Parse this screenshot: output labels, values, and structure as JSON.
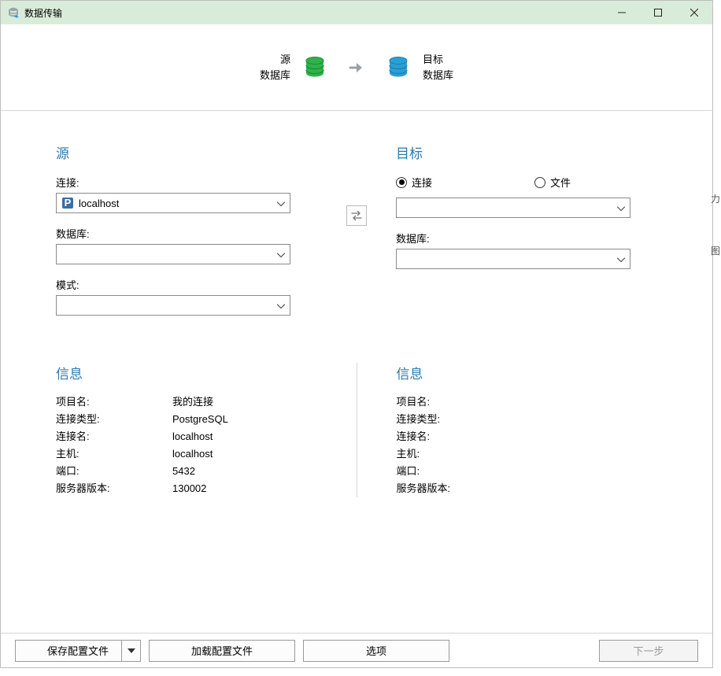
{
  "window": {
    "title": "数据传输"
  },
  "header": {
    "source_label1": "源",
    "source_label2": "数据库",
    "target_label1": "目标",
    "target_label2": "数据库"
  },
  "source": {
    "section": "源",
    "connection_label": "连接:",
    "connection_value": "localhost",
    "database_label": "数据库:",
    "database_value": "",
    "schema_label": "模式:",
    "schema_value": ""
  },
  "target": {
    "section": "目标",
    "radio_connection": "连接",
    "radio_file": "文件",
    "connection_value": "",
    "database_label": "数据库:",
    "database_value": ""
  },
  "info_source": {
    "section": "信息",
    "rows": [
      {
        "label": "项目名:",
        "value": "我的连接"
      },
      {
        "label": "连接类型:",
        "value": "PostgreSQL"
      },
      {
        "label": "连接名:",
        "value": "localhost"
      },
      {
        "label": "主机:",
        "value": "localhost"
      },
      {
        "label": "端口:",
        "value": "5432"
      },
      {
        "label": "服务器版本:",
        "value": "130002"
      }
    ]
  },
  "info_target": {
    "section": "信息",
    "rows": [
      {
        "label": "项目名:",
        "value": ""
      },
      {
        "label": "连接类型:",
        "value": ""
      },
      {
        "label": "连接名:",
        "value": ""
      },
      {
        "label": "主机:",
        "value": ""
      },
      {
        "label": "端口:",
        "value": ""
      },
      {
        "label": "服务器版本:",
        "value": ""
      }
    ]
  },
  "footer": {
    "save_profile": "保存配置文件",
    "load_profile": "加载配置文件",
    "options": "选项",
    "next": "下一步"
  },
  "edge_hints": {
    "a": "力",
    "b": "图"
  }
}
